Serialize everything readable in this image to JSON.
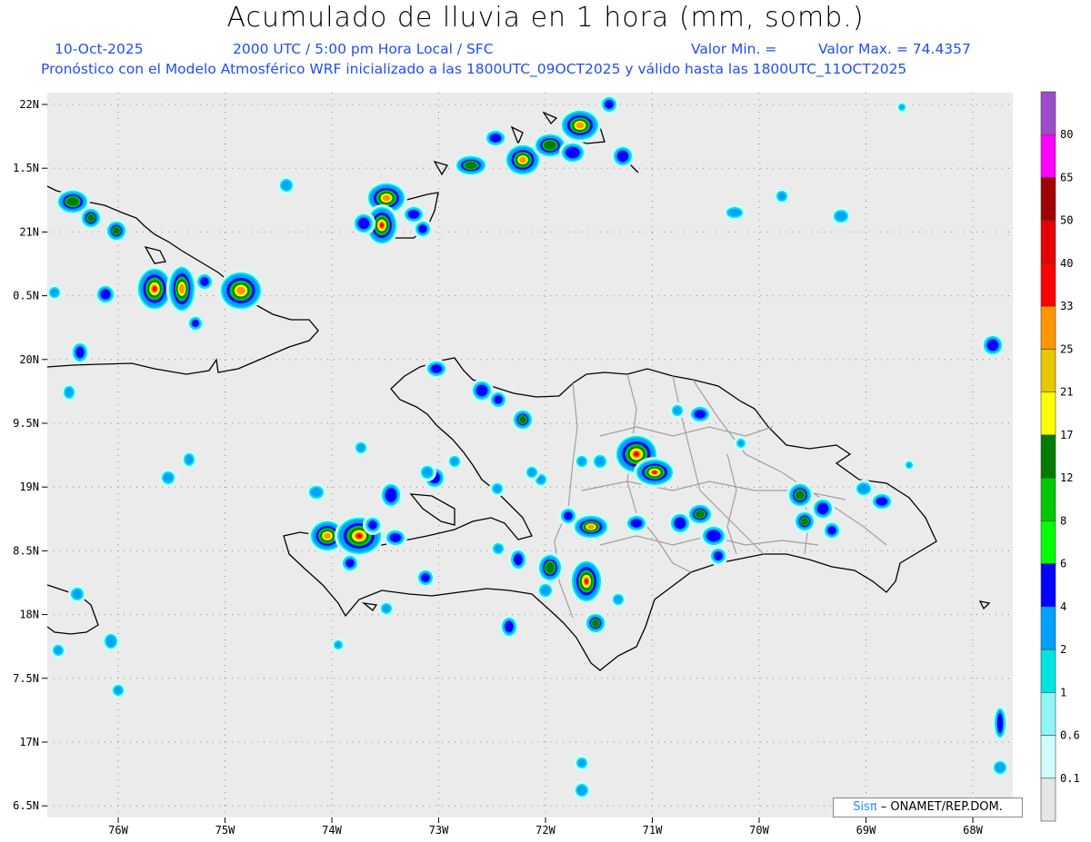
{
  "header": {
    "title": "Acumulado de lluvia en 1 hora (mm, somb.)",
    "date": "10-Oct-2025",
    "time": "2000 UTC / 5:00 pm Hora Local / SFC",
    "min_label": "Valor Min. =",
    "max_label": "Valor Max. = 74.4357",
    "forecast": "Pronóstico con el Modelo Atmosférico WRF inicializado a las 1800UTC_09OCT2025 y válido hasta las  1800UTC_11OCT2025"
  },
  "axes": {
    "lon_ticks": [
      "76W",
      "75W",
      "74W",
      "73W",
      "72W",
      "71W",
      "70W",
      "69W",
      "68W"
    ],
    "lat_ticks": [
      "22N",
      "1.5N",
      "21N",
      "0.5N",
      "20N",
      "9.5N",
      "19N",
      "8.5N",
      "18N",
      "7.5N",
      "17N",
      "6.5N"
    ]
  },
  "legend": {
    "levels": [
      {
        "label": "0.1",
        "color": "#e6e6e6"
      },
      {
        "label": "0.6",
        "color": "#cffbfb"
      },
      {
        "label": "1",
        "color": "#8ff5f5"
      },
      {
        "label": "2",
        "color": "#00e3e3"
      },
      {
        "label": "4",
        "color": "#00a0ff"
      },
      {
        "label": "6",
        "color": "#0000ff"
      },
      {
        "label": "8",
        "color": "#00ff00"
      },
      {
        "label": "12",
        "color": "#00c800"
      },
      {
        "label": "17",
        "color": "#007d00"
      },
      {
        "label": "21",
        "color": "#ffff00"
      },
      {
        "label": "25",
        "color": "#e6c800"
      },
      {
        "label": "33",
        "color": "#ff9600"
      },
      {
        "label": "40",
        "color": "#ff0000"
      },
      {
        "label": "50",
        "color": "#e60000"
      },
      {
        "label": "65",
        "color": "#a00000"
      },
      {
        "label": "80",
        "color": "#ff00ff"
      },
      {
        "label": "",
        "color": "#9d4cc8"
      }
    ]
  },
  "credit": {
    "brand": "Sis",
    "pi": "π",
    "org": " – ONAMET/REP.DOM."
  },
  "colors": {
    "plot_bg": "#ebebeb",
    "subtitle": "#1f4dff",
    "coast": "#000000",
    "provinces": "#a0a0a0"
  }
}
